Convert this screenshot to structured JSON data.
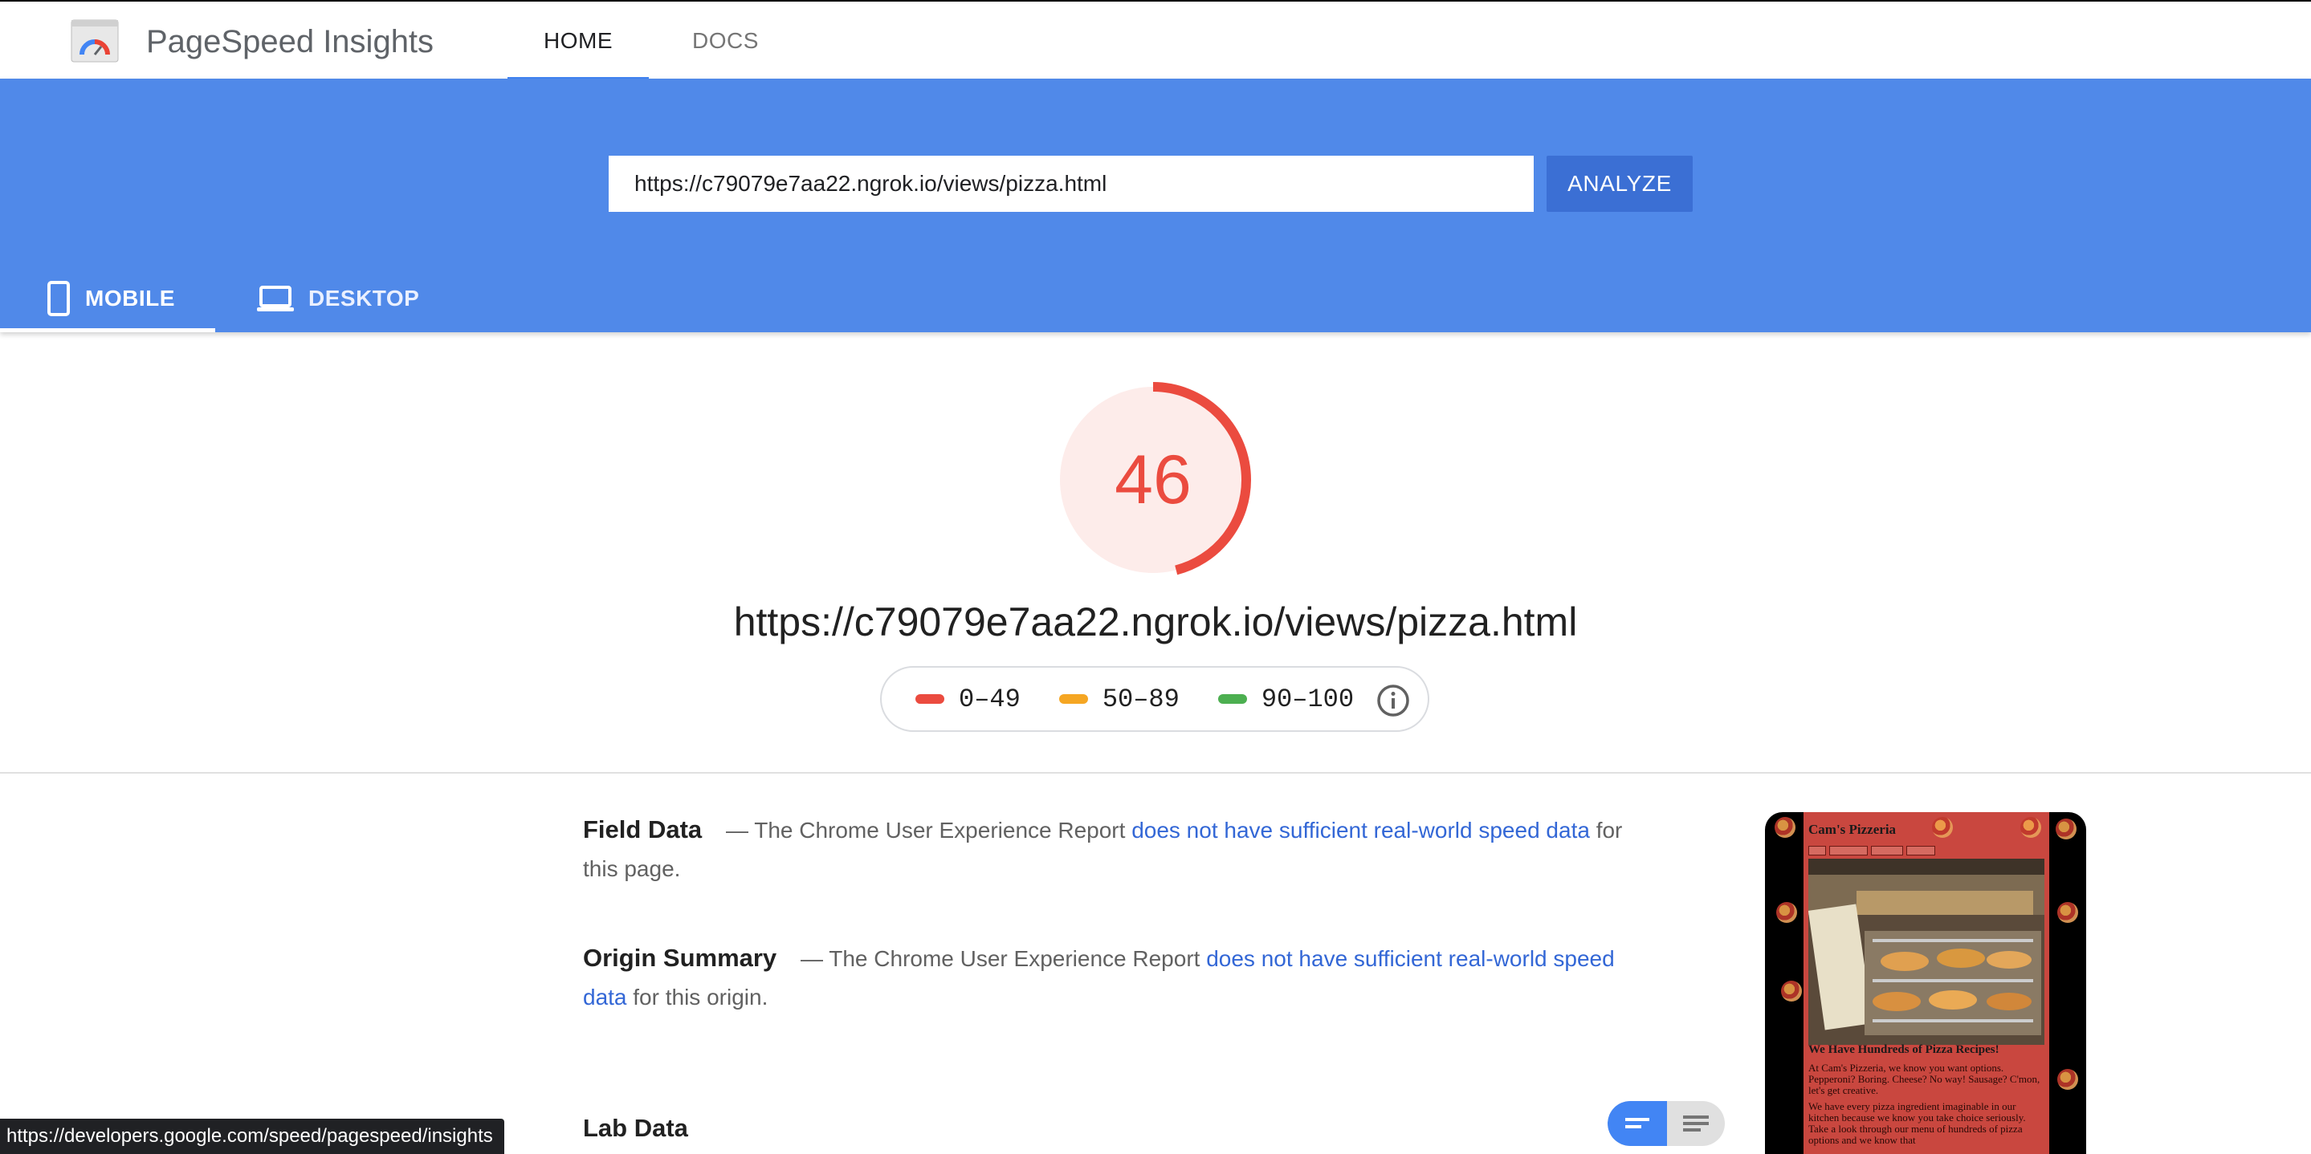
{
  "app": {
    "title": "PageSpeed Insights",
    "nav": [
      {
        "label": "HOME",
        "active": true
      },
      {
        "label": "DOCS",
        "active": false
      }
    ]
  },
  "search": {
    "url_value": "https://c79079e7aa22.ngrok.io/views/pizza.html",
    "analyze_label": "ANALYZE"
  },
  "device_tabs": [
    {
      "label": "MOBILE",
      "icon": "smartphone-icon",
      "active": true
    },
    {
      "label": "DESKTOP",
      "icon": "laptop-icon",
      "active": false
    }
  ],
  "score": {
    "value": "46",
    "fraction": 0.46,
    "color": "#eb4b3f",
    "tested_url": "https://c79079e7aa22.ngrok.io/views/pizza.html"
  },
  "legend": [
    {
      "range": "0–49",
      "color": "#eb4b3f"
    },
    {
      "range": "50–89",
      "color": "#f5a623"
    },
    {
      "range": "90–100",
      "color": "#4caf50"
    }
  ],
  "field_data": {
    "heading": "Field Data",
    "prefix": "— The Chrome User Experience Report",
    "link": "does not have sufficient real-world speed data",
    "suffix": "for this page."
  },
  "origin_summary": {
    "heading": "Origin Summary",
    "prefix": "— The Chrome User Experience Report",
    "link": "does not have sufficient real-world speed data",
    "suffix": "for this origin."
  },
  "lab_data": {
    "heading": "Lab Data"
  },
  "screenshot": {
    "site_title": "Cam's Pizzeria",
    "heading": "We Have Hundreds of Pizza Recipes!",
    "body_1": "At Cam's Pizzeria, we know you want options. Pepperoni? Boring. Cheese? No way! Sausage? C'mon, let's get creative.",
    "body_2": "We have every pizza ingredient imaginable in our kitchen because we know you take choice seriously. Take a look through our menu of hundreds of pizza options and we know that"
  },
  "status_url": "https://developers.google.com/speed/pagespeed/insights",
  "colors": {
    "brand_blue": "#5089e9",
    "analyze_blue": "#3b6fd4",
    "link_blue": "#3367d6"
  }
}
